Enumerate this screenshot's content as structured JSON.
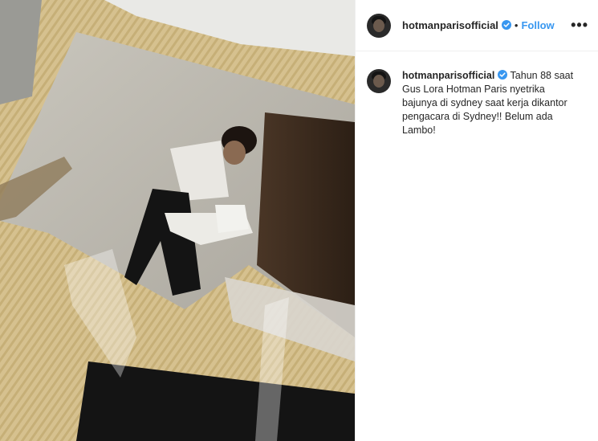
{
  "post": {
    "username": "hotmanparisofficial",
    "follow_label": "Follow",
    "separator": "•",
    "more_label": "•••",
    "caption": {
      "username": "hotmanparisofficial",
      "lines": [
        "Tahun 88 saat",
        "Gus Lora Hotman Paris nyetrika",
        "bajunya di sydney saat kerja dikantor",
        "pengacara di Sydney!! Belum ada",
        "Lambo!"
      ]
    }
  },
  "colors": {
    "link": "#3897f0",
    "text": "#262626",
    "verified": "#3897f0"
  },
  "icons": {
    "verified": "verified-badge-icon",
    "more": "more-options-icon"
  }
}
